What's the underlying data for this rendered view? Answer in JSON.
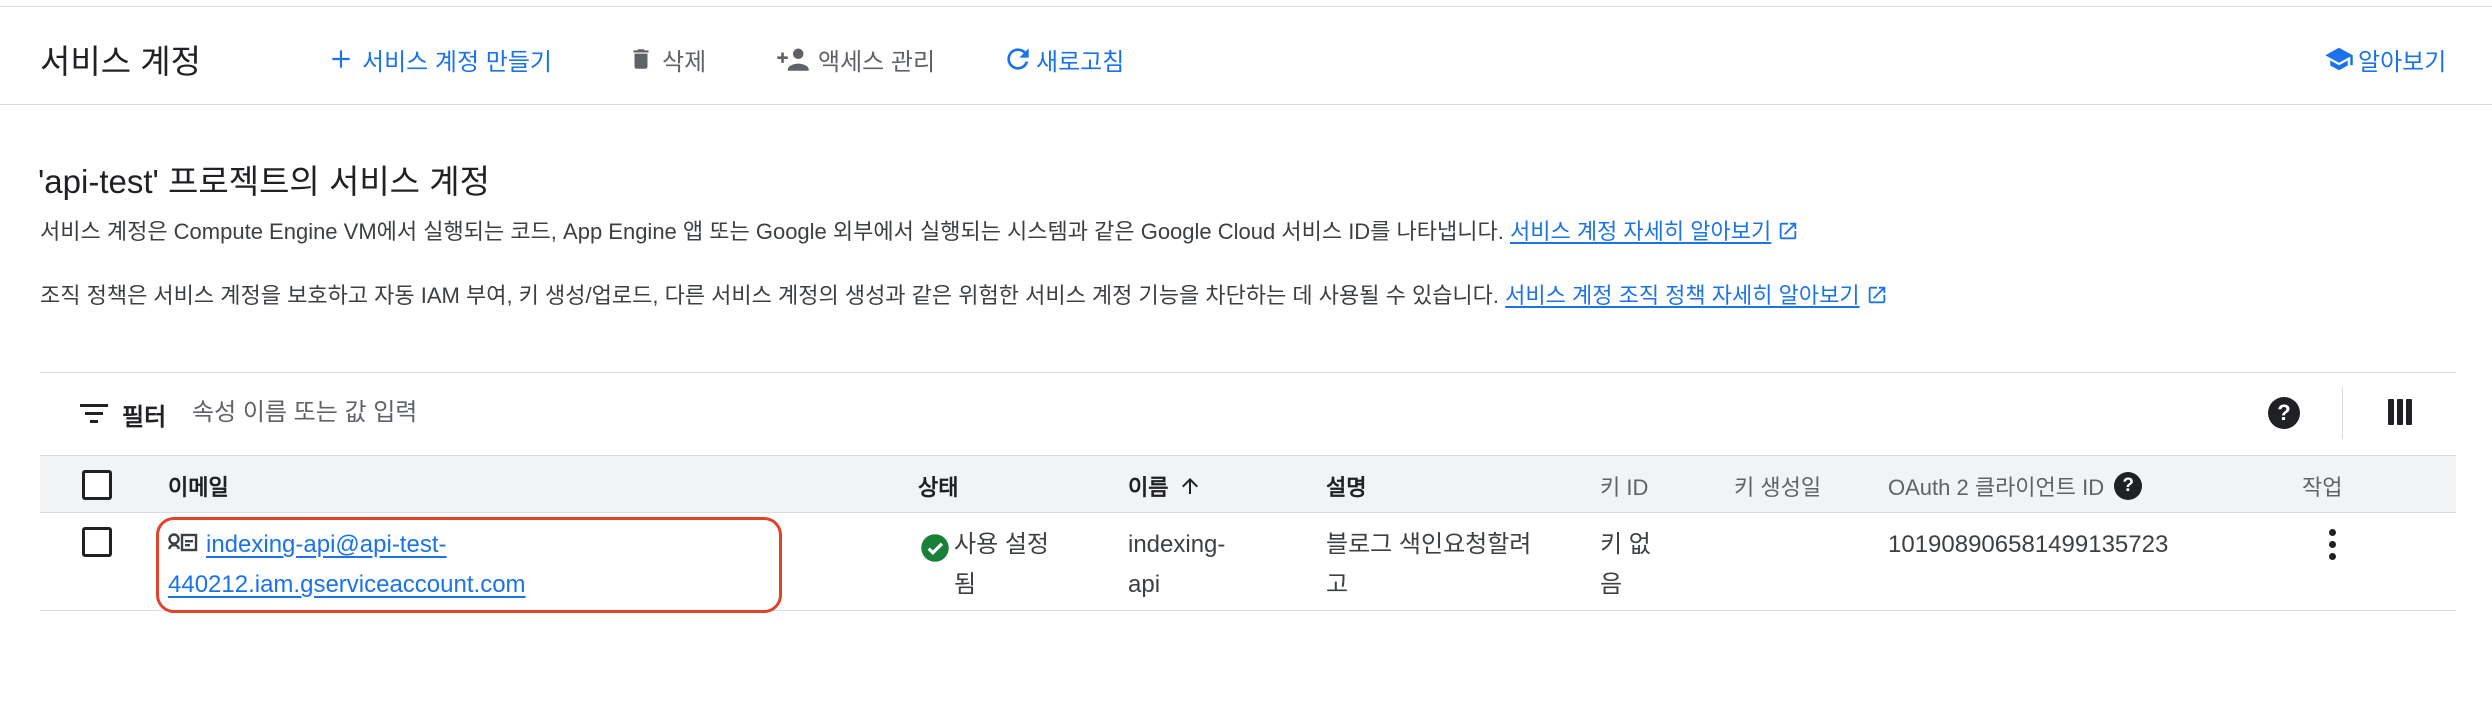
{
  "header": {
    "title": "서비스 계정",
    "create_label": "서비스 계정 만들기",
    "delete_label": "삭제",
    "manage_access_label": "액세스 관리",
    "refresh_label": "새로고침",
    "learn_label": "알아보기"
  },
  "section": {
    "title": "'api-test' 프로젝트의 서비스 계정",
    "desc1": "서비스 계정은 Compute Engine VM에서 실행되는 코드, App Engine 앱 또는 Google 외부에서 실행되는 시스템과 같은 Google Cloud 서비스 ID를 나타냅니다.",
    "desc1_link": "서비스 계정 자세히 알아보기",
    "desc2": "조직 정책은 서비스 계정을 보호하고 자동 IAM 부여, 키 생성/업로드, 다른 서비스 계정의 생성과 같은 위험한 서비스 계정 기능을 차단하는 데 사용될 수 있습니다.",
    "desc2_link": "서비스 계정 조직 정책 자세히 알아보기"
  },
  "filter": {
    "label": "필터",
    "placeholder": "속성 이름 또는 값 입력"
  },
  "table": {
    "columns": {
      "email": "이메일",
      "status": "상태",
      "name": "이름",
      "description": "설명",
      "key_id": "키 ID",
      "key_created": "키 생성일",
      "oauth_client_id": "OAuth 2 클라이언트 ID",
      "actions": "작업"
    },
    "rows": [
      {
        "email_line1": "indexing-api@api-test-",
        "email_line2": "440212.iam.gserviceaccount.com",
        "status_line1": "사용 설정",
        "status_line2": "됨",
        "name_line1": "indexing-",
        "name_line2": "api",
        "description_line1": "블로그 색인요청할려",
        "description_line2": "고",
        "key_id_line1": "키 없",
        "key_id_line2": "음",
        "key_created": "",
        "oauth_client_id": "101908906581499135723"
      }
    ]
  },
  "colors": {
    "accent": "#1a73e8",
    "highlight": "#e0422a",
    "success": "#188038",
    "header_bg": "#f1f3f4"
  }
}
